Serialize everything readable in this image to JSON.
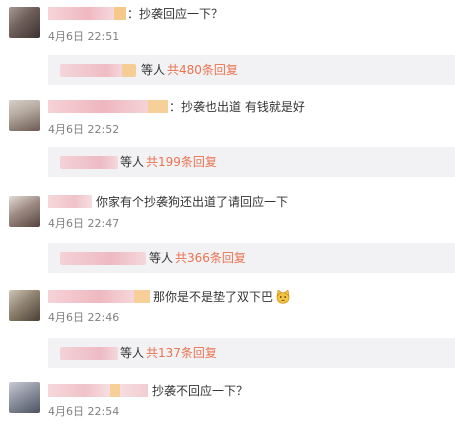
{
  "comments": [
    {
      "text": "：抄袭回应一下？",
      "time": "4月6日 22:51",
      "reply_people": "等人",
      "reply_link": "共480条回复"
    },
    {
      "text": "：抄袭也出道 有钱就是好",
      "time": "4月6日 22:52",
      "reply_people": "等人",
      "reply_link": "共199条回复"
    },
    {
      "text": "你家有个抄袭狗还出道了请回应一下",
      "time": "4月6日 22:47",
      "reply_people": "等人",
      "reply_link": "共366条回复"
    },
    {
      "text": "那你是不是垫了双下巴",
      "time": "4月6日 22:46",
      "reply_people": "等人",
      "reply_link": "共137条回复"
    },
    {
      "text": "抄袭不回应一下？",
      "time": "4月6日 22:54"
    }
  ],
  "colors": {
    "link": "#eb7350",
    "reply_bg": "#f2f2f5",
    "timestamp": "#808080",
    "text": "#333333"
  }
}
